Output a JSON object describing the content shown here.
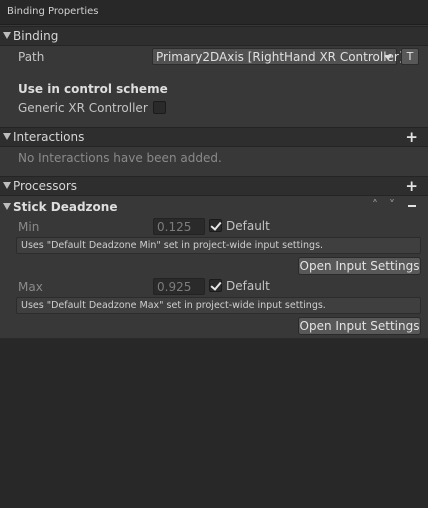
{
  "window": {
    "title": "Binding Properties"
  },
  "binding": {
    "header": "Binding",
    "path_label": "Path",
    "path_value": "Primary2DAxis [RightHand XR Controller]",
    "t_button": "T",
    "use_in_scheme": "Use in control scheme",
    "scheme_name": "Generic XR Controller",
    "scheme_checked": false
  },
  "interactions": {
    "header": "Interactions",
    "empty_text": "No Interactions have been added."
  },
  "processors": {
    "header": "Processors",
    "item": {
      "name": "Stick Deadzone",
      "min": {
        "label": "Min",
        "value": "0.125",
        "default_label": "Default",
        "default_checked": true,
        "help": "Uses \"Default Deadzone Min\" set in project-wide input settings.",
        "button": "Open Input Settings"
      },
      "max": {
        "label": "Max",
        "value": "0.925",
        "default_label": "Default",
        "default_checked": true,
        "help": "Uses \"Default Deadzone Max\" set in project-wide input settings.",
        "button": "Open Input Settings"
      }
    }
  },
  "icons": {
    "foldout": "triangle-down-icon",
    "add": "plus-icon",
    "move_up": "chevron-up-icon",
    "move_down": "chevron-down-icon",
    "remove": "minus-icon"
  },
  "colors": {
    "background": "#383838",
    "header": "#2e2e2e",
    "field": "#2a2a2a",
    "button": "#585858"
  }
}
